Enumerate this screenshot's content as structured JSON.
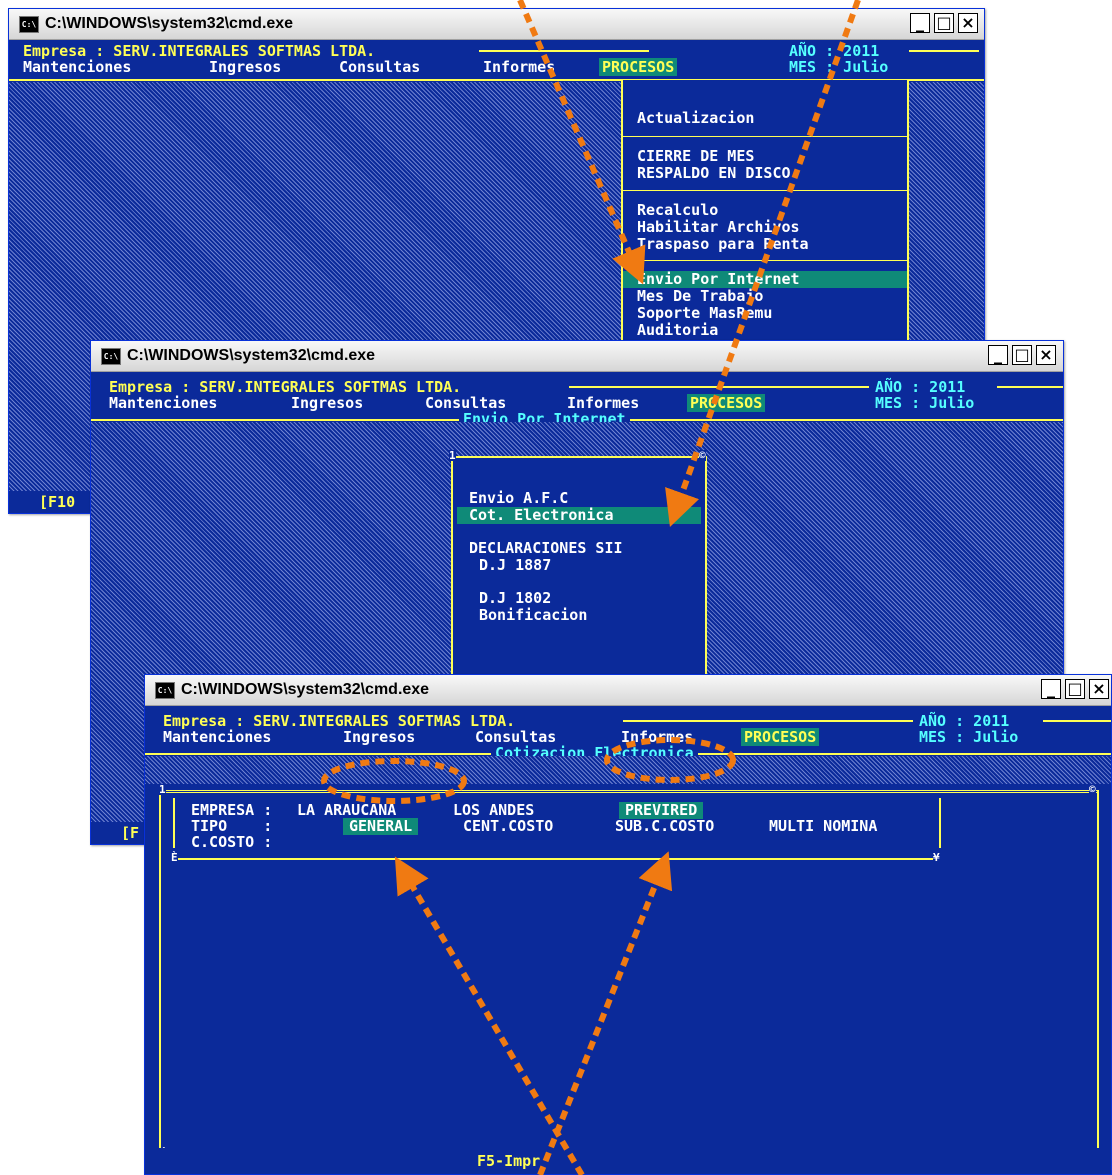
{
  "window_title": "C:\\WINDOWS\\system32\\cmd.exe",
  "window_buttons": {
    "minimize": "_",
    "maximize": "□",
    "close": "×"
  },
  "icon": {
    "name": "cmd-icon",
    "glyph": "C:\\"
  },
  "header": {
    "empresa": "Empresa : SERV.INTEGRALES SOFTMAS LTDA.",
    "anio": "AÑO : 2011",
    "mes": "MES : Julio",
    "menu": [
      "Mantenciones",
      "Ingresos",
      "Consultas",
      "Informes",
      "PROCESOS"
    ]
  },
  "window1": {
    "procesos_menu": {
      "group1": [
        "Actualizacion"
      ],
      "group2": [
        "CIERRE DE MES",
        "RESPALDO EN DISCO"
      ],
      "group3": [
        "Recalculo",
        "Habilitar Archivos",
        "Traspaso para Renta"
      ],
      "group4": [
        "Envio Por Internet",
        "Mes De Trabajo",
        "Soporte MasRemu",
        "Auditoria"
      ]
    },
    "status_fragment": "[F10"
  },
  "window2": {
    "subtitle": "Envio Por Internet",
    "box_left_number": "1",
    "box_right_number": "©",
    "items": [
      "Envio A.F.C",
      "Cot. Electronica"
    ],
    "section_header": "DECLARACIONES SII",
    "decl_items": [
      "D.J 1887",
      "D.J 1802",
      "Bonificacion"
    ],
    "status_fragment": "[F"
  },
  "window3": {
    "subtitle": "Cotizacion Electronica",
    "box_left_number": "1",
    "box_right_number": "©",
    "labels": {
      "empresa": "EMPRESA :",
      "tipo": "TIPO    :",
      "ccosto": "C.COSTO :"
    },
    "empresa_options": [
      "LA ARAUCANA",
      "LOS ANDES",
      "PREVIRED"
    ],
    "tipo_options": [
      "GENERAL",
      "CENT.COSTO",
      "SUB.C.COSTO",
      "MULTI NOMINA"
    ],
    "corner_e": "È",
    "corner_v": "¥",
    "footer": "F5-Impr"
  },
  "colors": {
    "console_bg": "#0b2a9a",
    "text_yellow": "#ffff55",
    "text_white": "#ffffff",
    "highlight": "#0f8a78",
    "annotation": "#f07a12"
  }
}
